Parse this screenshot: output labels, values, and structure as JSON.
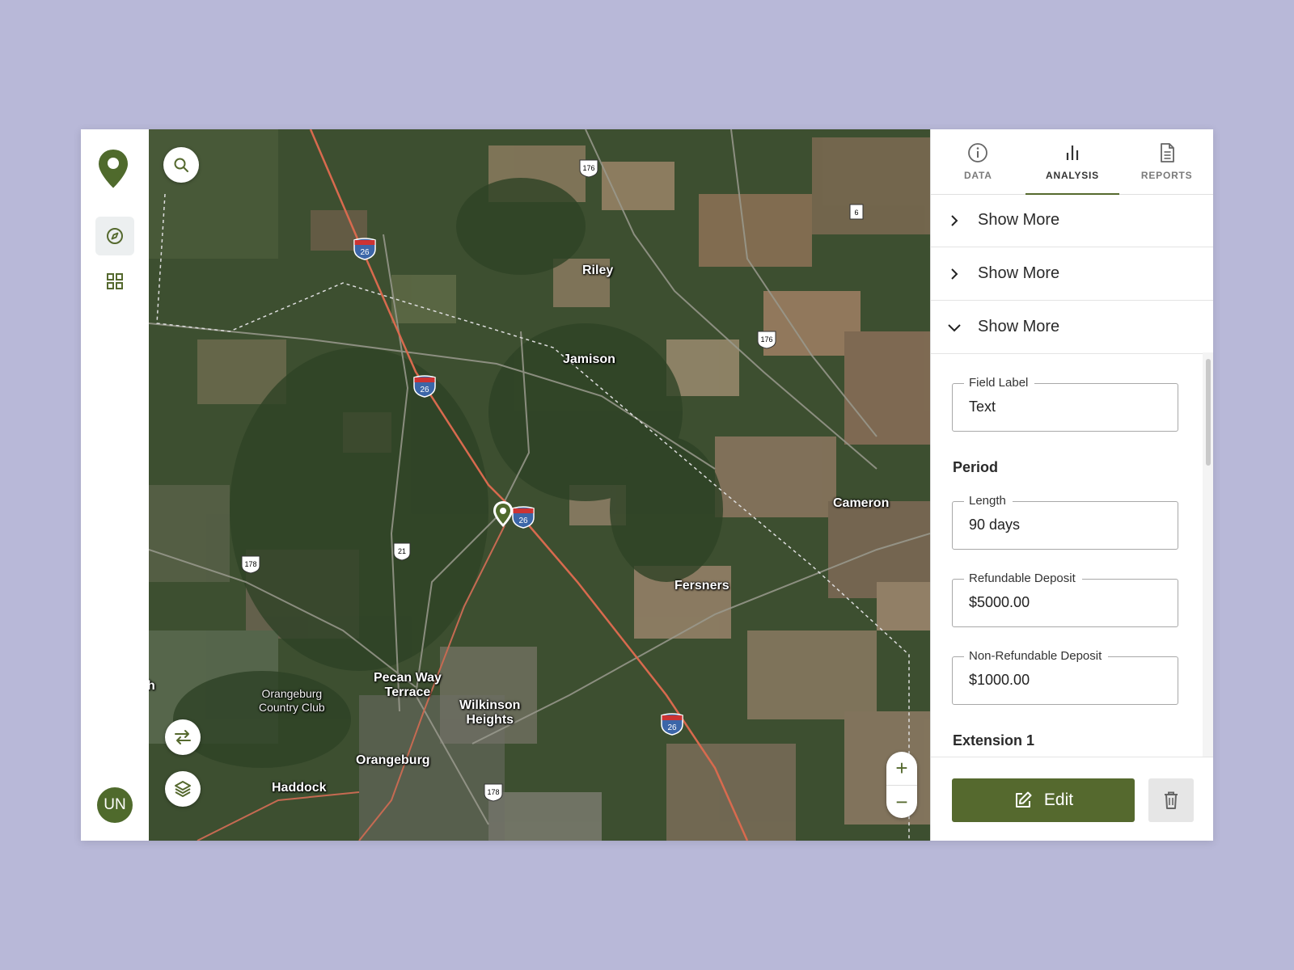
{
  "rail": {
    "avatar_initials": "UN",
    "items": [
      {
        "icon": "compass-icon",
        "active": true
      },
      {
        "icon": "grid-icon",
        "active": false
      }
    ]
  },
  "map": {
    "places": {
      "riley": "Riley",
      "jamison": "Jamison",
      "cameron": "Cameron",
      "fersners": "Fersners",
      "pecan_way_terrace_1": "Pecan Way",
      "pecan_way_terrace_2": "Terrace",
      "wilkinson_heights_1": "Wilkinson",
      "wilkinson_heights_2": "Heights",
      "orangeburg": "Orangeburg",
      "haddock": "Haddock",
      "orangeburg_cc_1": "Orangeburg",
      "orangeburg_cc_2": "Country Club",
      "edge_h": "h"
    },
    "shields": {
      "i26": "26",
      "us176": "176",
      "us178": "178",
      "us21": "21",
      "sc6": "6"
    },
    "zoom_in": "+",
    "zoom_out": "−"
  },
  "panel": {
    "tabs": [
      {
        "label": "DATA",
        "icon": "info-icon",
        "active": false
      },
      {
        "label": "ANALYSIS",
        "icon": "bar-chart-icon",
        "active": true
      },
      {
        "label": "REPORTS",
        "icon": "document-icon",
        "active": false
      }
    ],
    "accordions": [
      {
        "title": "Show More",
        "expanded": false
      },
      {
        "title": "Show More",
        "expanded": false
      },
      {
        "title": "Show More",
        "expanded": true
      }
    ],
    "fields": {
      "field_label": {
        "label": "Field Label",
        "value": "Text"
      },
      "length": {
        "label": "Length",
        "value": "90 days"
      },
      "refundable_deposit": {
        "label": "Refundable Deposit",
        "value": "$5000.00"
      },
      "non_refundable_deposit": {
        "label": "Non-Refundable Deposit",
        "value": "$1000.00"
      }
    },
    "sections": {
      "period": "Period",
      "extension_1": "Extension 1"
    },
    "edit_label": "Edit"
  },
  "colors": {
    "accent": "#55692e",
    "background": "#b8b8d8"
  }
}
